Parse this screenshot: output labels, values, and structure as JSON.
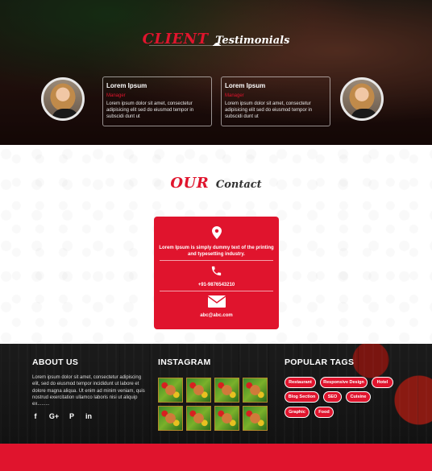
{
  "testimonials": {
    "title_accent": "CLIENT",
    "title_rest": "Testimonials",
    "items": [
      {
        "name": "Lorem Ipsum",
        "role": "Manager",
        "text": "Lorem ipsum dolor sit amet, consectetur adipisicing elit sed do eiusmod tempor in subscidi dunt ut"
      },
      {
        "name": "Lorem Ipsum",
        "role": "Manager",
        "text": "Lorem ipsum dolor sit amet, consectetur adipisicing elit sed do eiusmod tempor in subscidi dunt ut"
      }
    ]
  },
  "contact": {
    "title_accent": "OUR",
    "title_rest": "Contact",
    "address": "Lorem Ipsum is simply dummy text of the printing and typesetting industry.",
    "phone": "+91-9876543210",
    "email": "abc@abc.com",
    "icons": [
      "location-pin-icon",
      "phone-icon",
      "envelope-icon"
    ]
  },
  "footer": {
    "about": {
      "heading": "ABOUT US",
      "text": "Lorem ipsum dolor sit amet, consectetur adipiscing elit, sed do eiusmod tempor incididunt ut labore et dolore magna aliqua. Ut enim ad minim veniam, quis nostrud exercitation ullamco laboris nisi ut aliquip ex.........",
      "social": [
        {
          "name": "facebook-icon",
          "glyph": "f"
        },
        {
          "name": "google-plus-icon",
          "glyph": "G+"
        },
        {
          "name": "pinterest-icon",
          "glyph": "P"
        },
        {
          "name": "linkedin-icon",
          "glyph": "in"
        }
      ]
    },
    "instagram": {
      "heading": "INSTAGRAM",
      "photo_count": 8
    },
    "tags": {
      "heading": "POPULAR TAGS",
      "items": [
        "Restaurant",
        "Responsive Design",
        "Hotel",
        "Blog Section",
        "SEO",
        "Cuisine",
        "Graphic",
        "Food"
      ]
    }
  },
  "colors": {
    "accent": "#e0142d",
    "footer_bg": "#141414"
  }
}
